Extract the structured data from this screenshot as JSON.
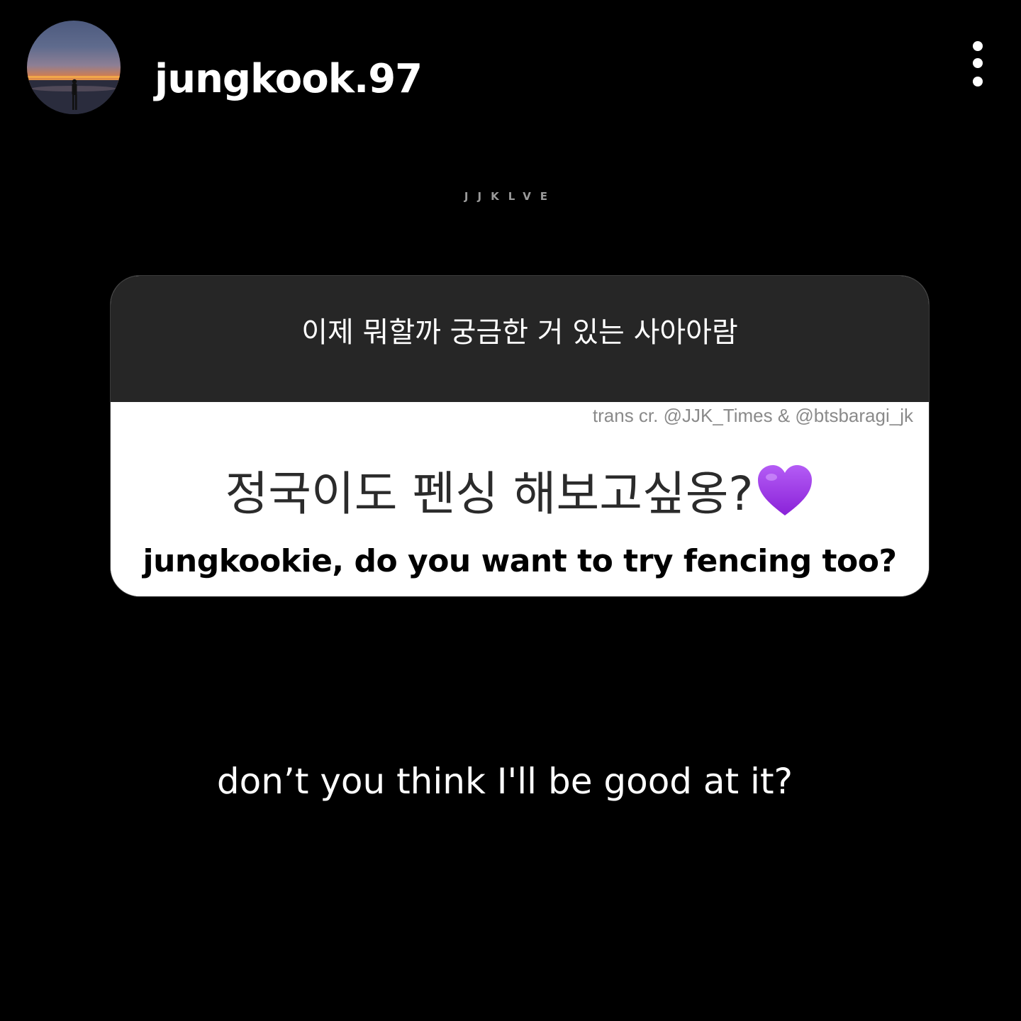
{
  "header": {
    "username": "jungkook.97",
    "more_icon": "vertical-dots-icon",
    "avatar_icon": "sunset-silhouette-avatar"
  },
  "watermark": "JJKLVE",
  "question_card": {
    "prompt": "이제 뭐할까 궁금한 거 있는 사아아람",
    "credit": "trans cr. @JJK_Times & @btsbaragi_jk",
    "question": "정국이도 펜싱 해보고싶옹?",
    "question_icon": "purple-heart-icon",
    "translation": "jungkookie, do you want to try fencing too?",
    "colors": {
      "header_bg": "#262626",
      "body_bg": "#ffffff",
      "heart": "#9b30e8"
    }
  },
  "answer": "don’t you think I'll be good at it?"
}
